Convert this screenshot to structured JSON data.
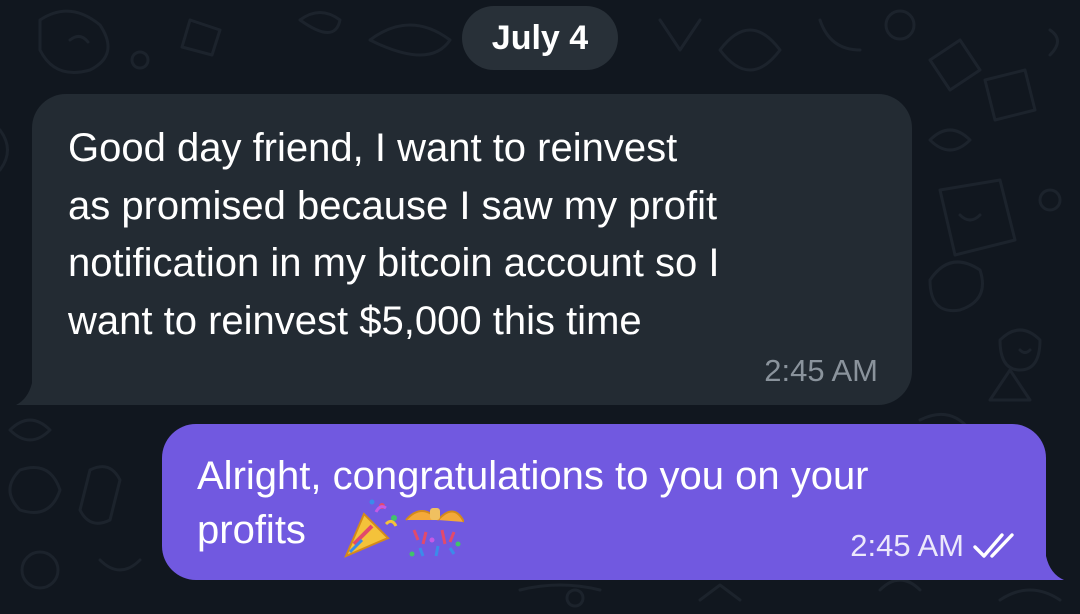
{
  "chat": {
    "date_separator": "July 4",
    "messages": [
      {
        "direction": "incoming",
        "text": "Good day friend, I want to reinvest\nas promised because I saw my profit\nnotification in my bitcoin account so I\nwant to reinvest $5,000 this time",
        "time": "2:45 AM"
      },
      {
        "direction": "outgoing",
        "text": "Alright, congratulations to you on your\nprofits",
        "emojis": [
          "party-popper",
          "confetti-ball"
        ],
        "time": "2:45 AM",
        "status_icon": "double-check-icon"
      }
    ]
  },
  "colors": {
    "background": "#11171f",
    "incoming_bubble": "#232b33",
    "outgoing_bubble": "#7159e0",
    "date_pill": "#283038",
    "incoming_time": "#8a939c",
    "outgoing_time": "#ece8fb"
  }
}
